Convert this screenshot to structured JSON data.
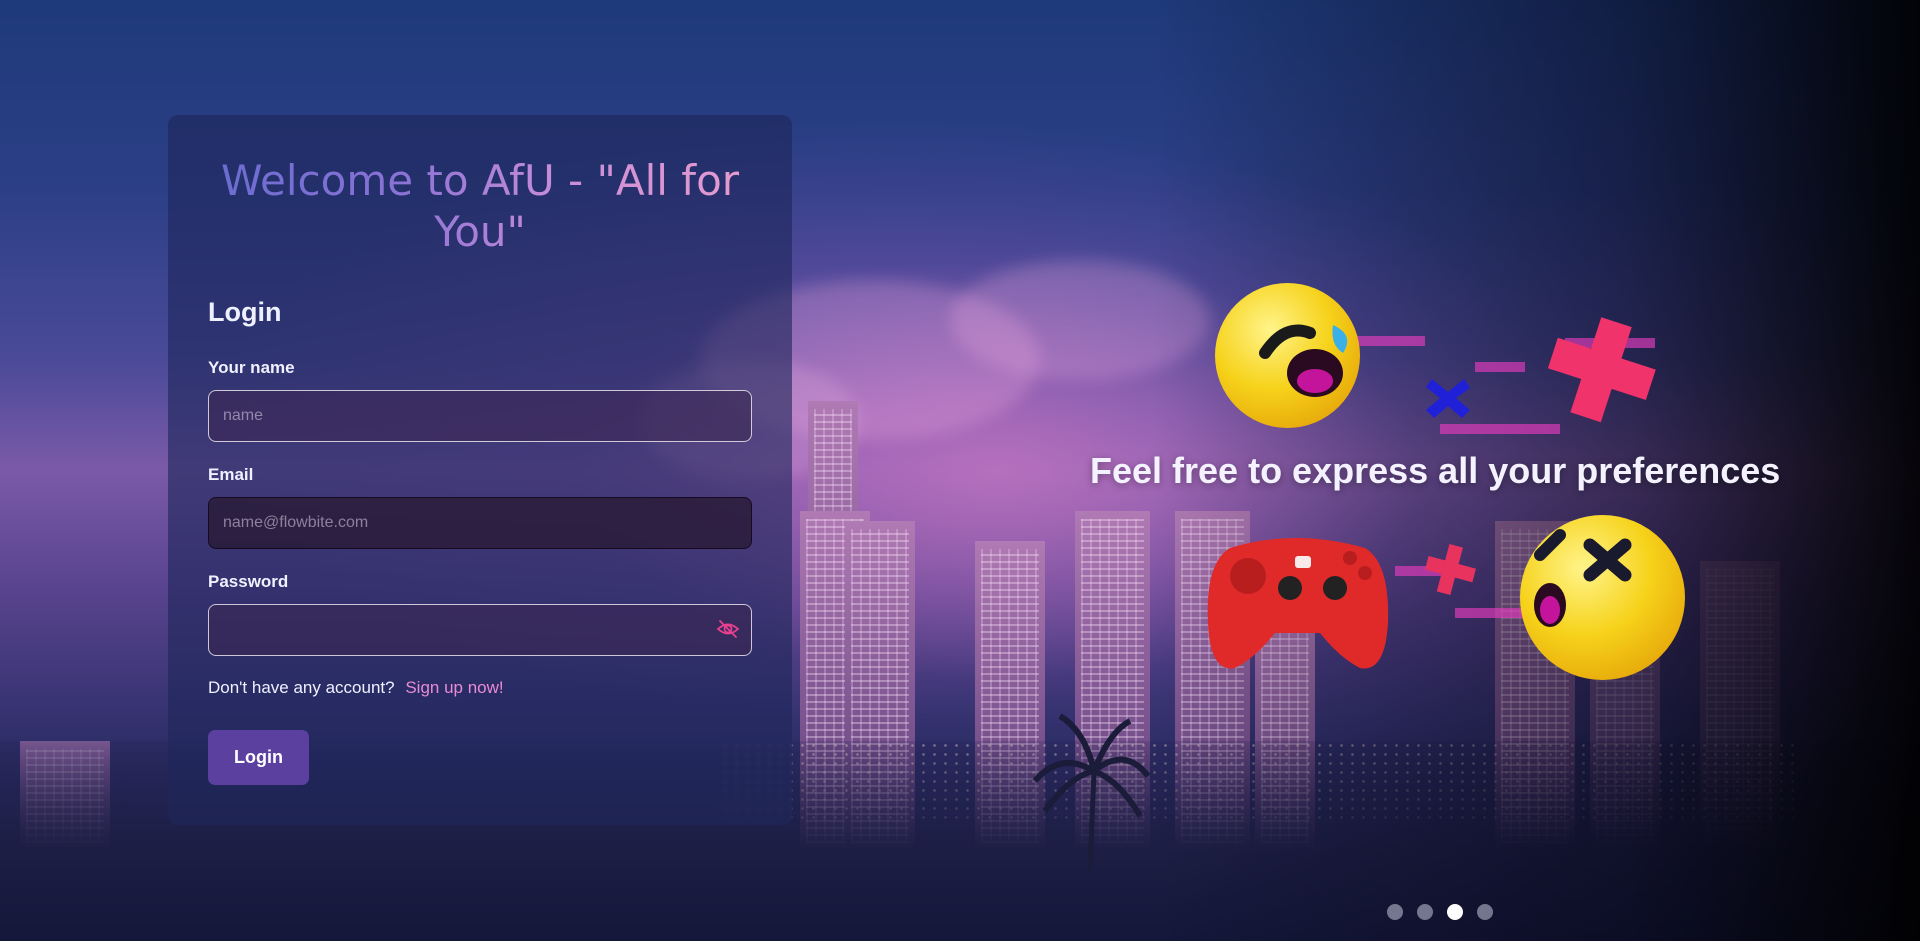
{
  "welcome": {
    "title": "Welcome to AfU - \"All for You\""
  },
  "login": {
    "heading": "Login",
    "name_label": "Your name",
    "name_placeholder": "name",
    "email_label": "Email",
    "email_placeholder": "name@flowbite.com",
    "password_label": "Password",
    "password_placeholder": "",
    "password_toggle_icon": "eye-slash-icon",
    "signup_prompt": "Don't have any account?",
    "signup_link": "Sign up now!",
    "submit_label": "Login"
  },
  "carousel": {
    "slide_text": "Feel free to express all your preferences",
    "slide_count": 4,
    "active_index": 2
  },
  "colors": {
    "button": "#5b40a0",
    "link": "#e88bd4",
    "card": "#1e265a"
  }
}
